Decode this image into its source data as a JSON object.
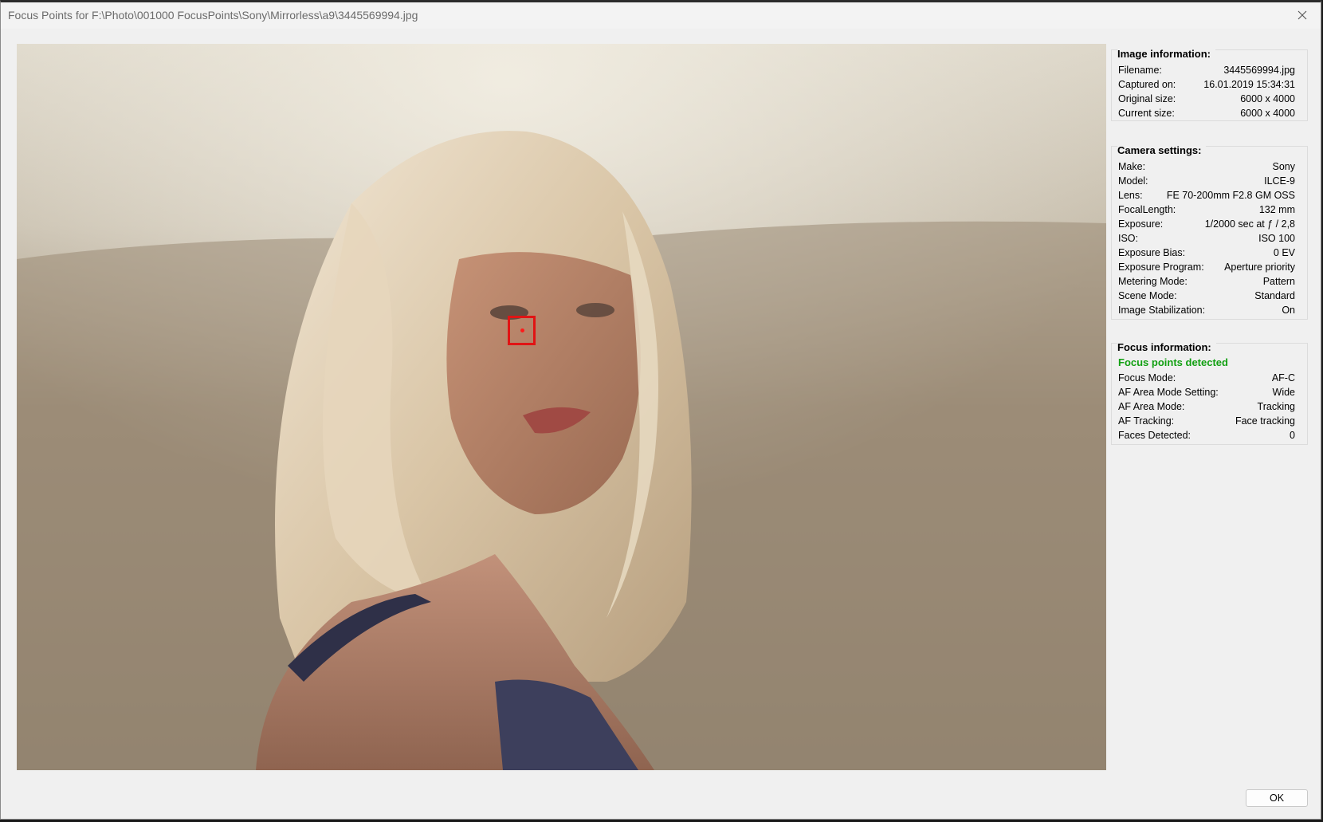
{
  "window": {
    "title": "Focus Points for F:\\Photo\\001000 FocusPoints\\Sony\\Mirrorless\\a9\\3445569994.jpg",
    "close_icon": "close-icon"
  },
  "photo": {
    "focus_point_color": "#e11414"
  },
  "image_information": {
    "title": "Image information:",
    "rows": [
      {
        "label": "Filename:",
        "value": "3445569994.jpg"
      },
      {
        "label": "Captured on:",
        "value": "16.01.2019 15:34:31"
      },
      {
        "label": "Original size:",
        "value": "6000 x 4000"
      },
      {
        "label": "Current size:",
        "value": "6000 x 4000"
      }
    ]
  },
  "camera_settings": {
    "title": "Camera settings:",
    "rows": [
      {
        "label": "Make:",
        "value": "Sony"
      },
      {
        "label": "Model:",
        "value": "ILCE-9"
      },
      {
        "label": "Lens:",
        "value": "FE 70-200mm F2.8 GM OSS"
      },
      {
        "label": "FocalLength:",
        "value": "132 mm"
      },
      {
        "label": "Exposure:",
        "value": "1/2000 sec at ƒ / 2,8"
      },
      {
        "label": "ISO:",
        "value": "ISO 100"
      },
      {
        "label": "Exposure Bias:",
        "value": "0 EV"
      },
      {
        "label": "Exposure Program:",
        "value": "Aperture priority"
      },
      {
        "label": "Metering Mode:",
        "value": "Pattern"
      },
      {
        "label": "Scene Mode:",
        "value": "Standard"
      },
      {
        "label": "Image Stabilization:",
        "value": "On"
      }
    ]
  },
  "focus_information": {
    "title": "Focus information:",
    "status": "Focus points detected",
    "status_color": "#12a012",
    "rows": [
      {
        "label": "Focus Mode:",
        "value": "AF-C"
      },
      {
        "label": "AF Area Mode Setting:",
        "value": "Wide"
      },
      {
        "label": "AF Area Mode:",
        "value": "Tracking"
      },
      {
        "label": "AF Tracking:",
        "value": "Face tracking"
      },
      {
        "label": "Faces Detected:",
        "value": "0"
      }
    ]
  },
  "footer": {
    "ok_label": "OK"
  }
}
